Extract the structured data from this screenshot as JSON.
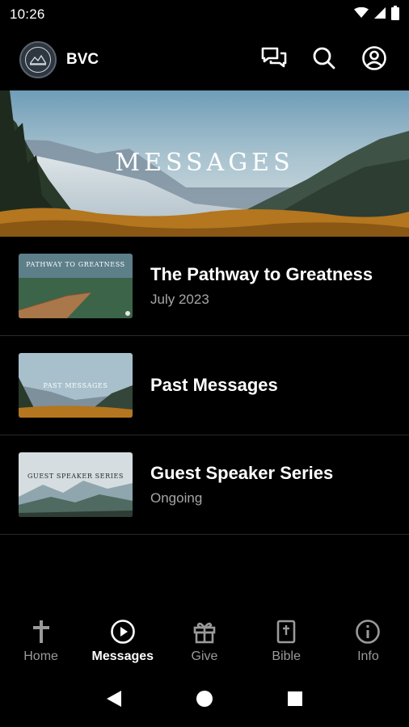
{
  "status_bar": {
    "time": "10:26"
  },
  "app_bar": {
    "title": "BVC"
  },
  "hero": {
    "title": "MESSAGES"
  },
  "list": [
    {
      "thumb_text": "PATHWAY TO GREATNESS",
      "title": "The Pathway to Greatness",
      "subtitle": "July 2023"
    },
    {
      "thumb_text": "PAST MESSAGES",
      "title": "Past Messages",
      "subtitle": ""
    },
    {
      "thumb_text": "GUEST SPEAKER SERIES",
      "title": "Guest Speaker Series",
      "subtitle": "Ongoing"
    }
  ],
  "bottom_nav": [
    {
      "label": "Home",
      "icon": "cross-icon",
      "active": false
    },
    {
      "label": "Messages",
      "icon": "play-circle-icon",
      "active": true
    },
    {
      "label": "Give",
      "icon": "gift-icon",
      "active": false
    },
    {
      "label": "Bible",
      "icon": "bible-icon",
      "active": false
    },
    {
      "label": "Info",
      "icon": "info-icon",
      "active": false
    }
  ],
  "colors": {
    "background": "#000000",
    "text": "#ffffff",
    "muted": "#a6a6a6",
    "nav_inactive": "#9a9a9a"
  }
}
